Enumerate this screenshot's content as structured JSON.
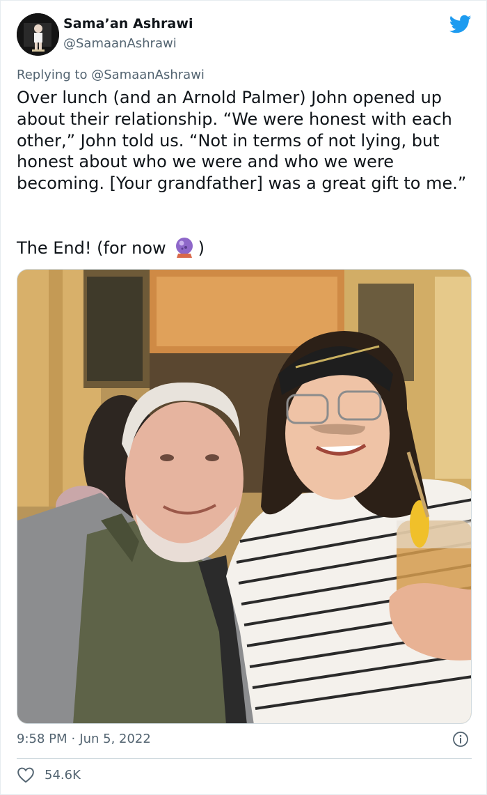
{
  "author": {
    "name": "Sama’an Ashrawi",
    "handle": "@SamaanAshrawi"
  },
  "reply": {
    "prefix": "Replying to ",
    "mention": "@SamaanAshrawi"
  },
  "tweet": {
    "text": "Over lunch (and an Arnold Palmer) John opened up about their relationship. “We were honest with each other,” John told us. “Not in terms of not lying, but honest about who we were and who we were becoming. [Your grandfather] was a great gift to me.”",
    "end_before": "The End! (for now",
    "end_after": ")",
    "emoji_icon": "crystal-ball-icon"
  },
  "meta": {
    "time": "9:58 PM",
    "separator": "·",
    "date": "Jun 5, 2022"
  },
  "stats": {
    "likes": "54.6K"
  },
  "colors": {
    "twitter_blue": "#1d9bf0",
    "secondary_text": "#536471",
    "divider": "#cfd9de"
  }
}
